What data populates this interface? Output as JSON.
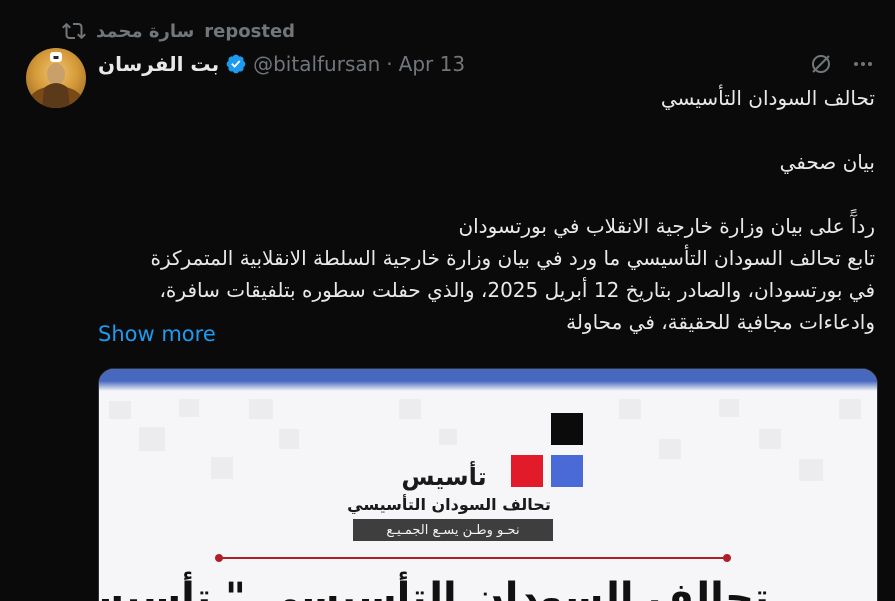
{
  "repost": {
    "icon": "repost-icon",
    "user": "سارة محمد",
    "label": "reposted"
  },
  "author": {
    "name": "بت الفرسان",
    "verified_icon": "verified-badge-icon",
    "handle": "@bitalfursan",
    "separator": "·",
    "date": "Apr 13"
  },
  "actions": {
    "grok_icon": "grok-icon",
    "more_icon": "more-icon"
  },
  "tweet": {
    "lines": [
      "تحالف السودان التأسيسي",
      "",
      "بيان صحفي",
      "",
      "ردآً على بيان وزارة خارجية الانقلاب في بورتسودان",
      "تابع تحالف السودان التأسيسي ما ورد في بيان وزارة خارجية السلطة الانقلابية المتمركزة",
      "في بورتسودان، والصادر بتاريخ 12 أبريل 2025، والذي حفلت سطوره بتلفيقات سافرة،",
      "وادعاءات مجافية للحقيقة، في محاولة"
    ],
    "show_more": "Show more"
  },
  "media": {
    "logo_word": "تأسيس",
    "logo_subtitle": "تحالف السودان التأسيسي",
    "slogan": "نحـو وطـن يسـع الجمـيـع",
    "headline": "تحالف السودان التأسيسي \" تأسيس \""
  },
  "colors": {
    "background": "#0a0a0a",
    "text": "#e7e9ea",
    "muted": "#71767b",
    "accent": "#1d9bf0",
    "logo_red": "#e21b2a",
    "logo_blue": "#4a6ad8",
    "media_bar": "#4768bf"
  }
}
